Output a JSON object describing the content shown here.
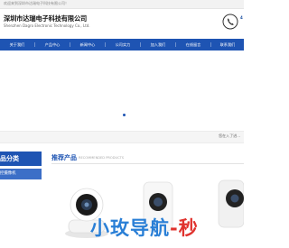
{
  "topbar": {
    "welcome_text": "欢迎来到深圳市达瑞电子科技有限公司！"
  },
  "header": {
    "company_name_cn": "深圳市达瑞电子科技有限公司",
    "company_name_en": "Shenzhen Dagro Electronic Technology Co., Ltd.",
    "phone_icon": "phone-icon",
    "phone_partial": "4"
  },
  "nav": {
    "items": [
      {
        "label": "关于我们"
      },
      {
        "label": "产品中心"
      },
      {
        "label": "新闻中心"
      },
      {
        "label": "公司实力"
      },
      {
        "label": "加入我们"
      },
      {
        "label": "在线留言"
      },
      {
        "label": "联系我们"
      }
    ]
  },
  "banner": {
    "slider_dots": 1
  },
  "breadcrumb": {
    "text": "您在入了进..."
  },
  "sidebar": {
    "heading": "品分类",
    "items": [
      {
        "label": "控摄像机"
      }
    ]
  },
  "recommended": {
    "title": "推荐产品",
    "subtitle": "RECOMMENDED PRODUCTS"
  },
  "watermark": {
    "text": "小玫导航-秒"
  },
  "colors": {
    "primary": "#1e54b3",
    "primary_light": "#3c6fc7",
    "watermark_blue": "#2a7fd6",
    "watermark_red": "#e0322d"
  }
}
